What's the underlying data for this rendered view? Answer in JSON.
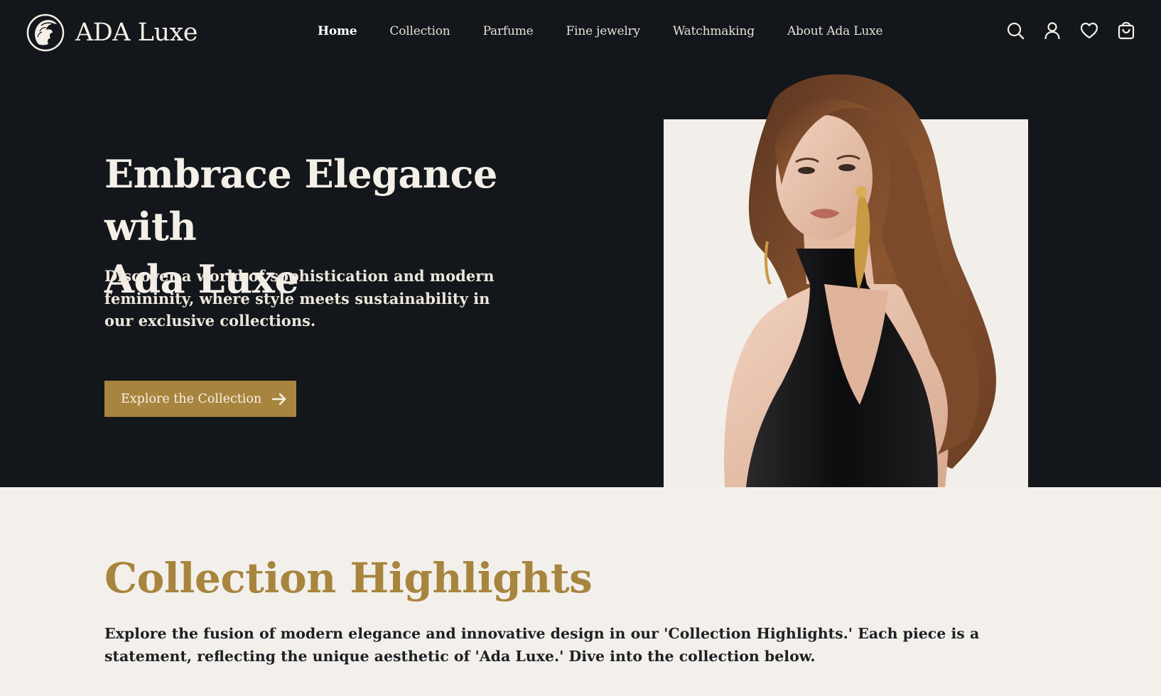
{
  "brand": {
    "name": "ADA Luxe",
    "logo_icon": "woman-profile-logo-icon"
  },
  "nav": {
    "items": [
      {
        "label": "Home",
        "active": true
      },
      {
        "label": "Collection",
        "active": false
      },
      {
        "label": "Parfume",
        "active": false
      },
      {
        "label": "Fine jewelry",
        "active": false
      },
      {
        "label": "Watchmaking",
        "active": false
      },
      {
        "label": "About Ada Luxe",
        "active": false
      }
    ]
  },
  "header_icons": [
    "search-icon",
    "user-icon",
    "heart-icon",
    "shopping-bag-icon"
  ],
  "hero": {
    "title_line1": "Embrace Elegance with",
    "title_line2": "Ada Luxe",
    "subtitle": "Discover a world of sophistication and modern femininity, where style meets sustainability in our exclusive collections.",
    "cta_label": "Explore the Collection",
    "cta_icon": "arrow-right-icon"
  },
  "highlights": {
    "title": "Collection Highlights",
    "description": "Explore the fusion of modern elegance and innovative design in our 'Collection Highlights.' Each piece is a statement, reflecting the unique aesthetic of 'Ada Luxe.' Dive into the collection below."
  },
  "colors": {
    "hero_background": "#13161a",
    "accent_gold": "#a8853e",
    "page_background": "#f3f0ec",
    "text_light": "#f4efe7",
    "text_dark": "#1e2024"
  }
}
